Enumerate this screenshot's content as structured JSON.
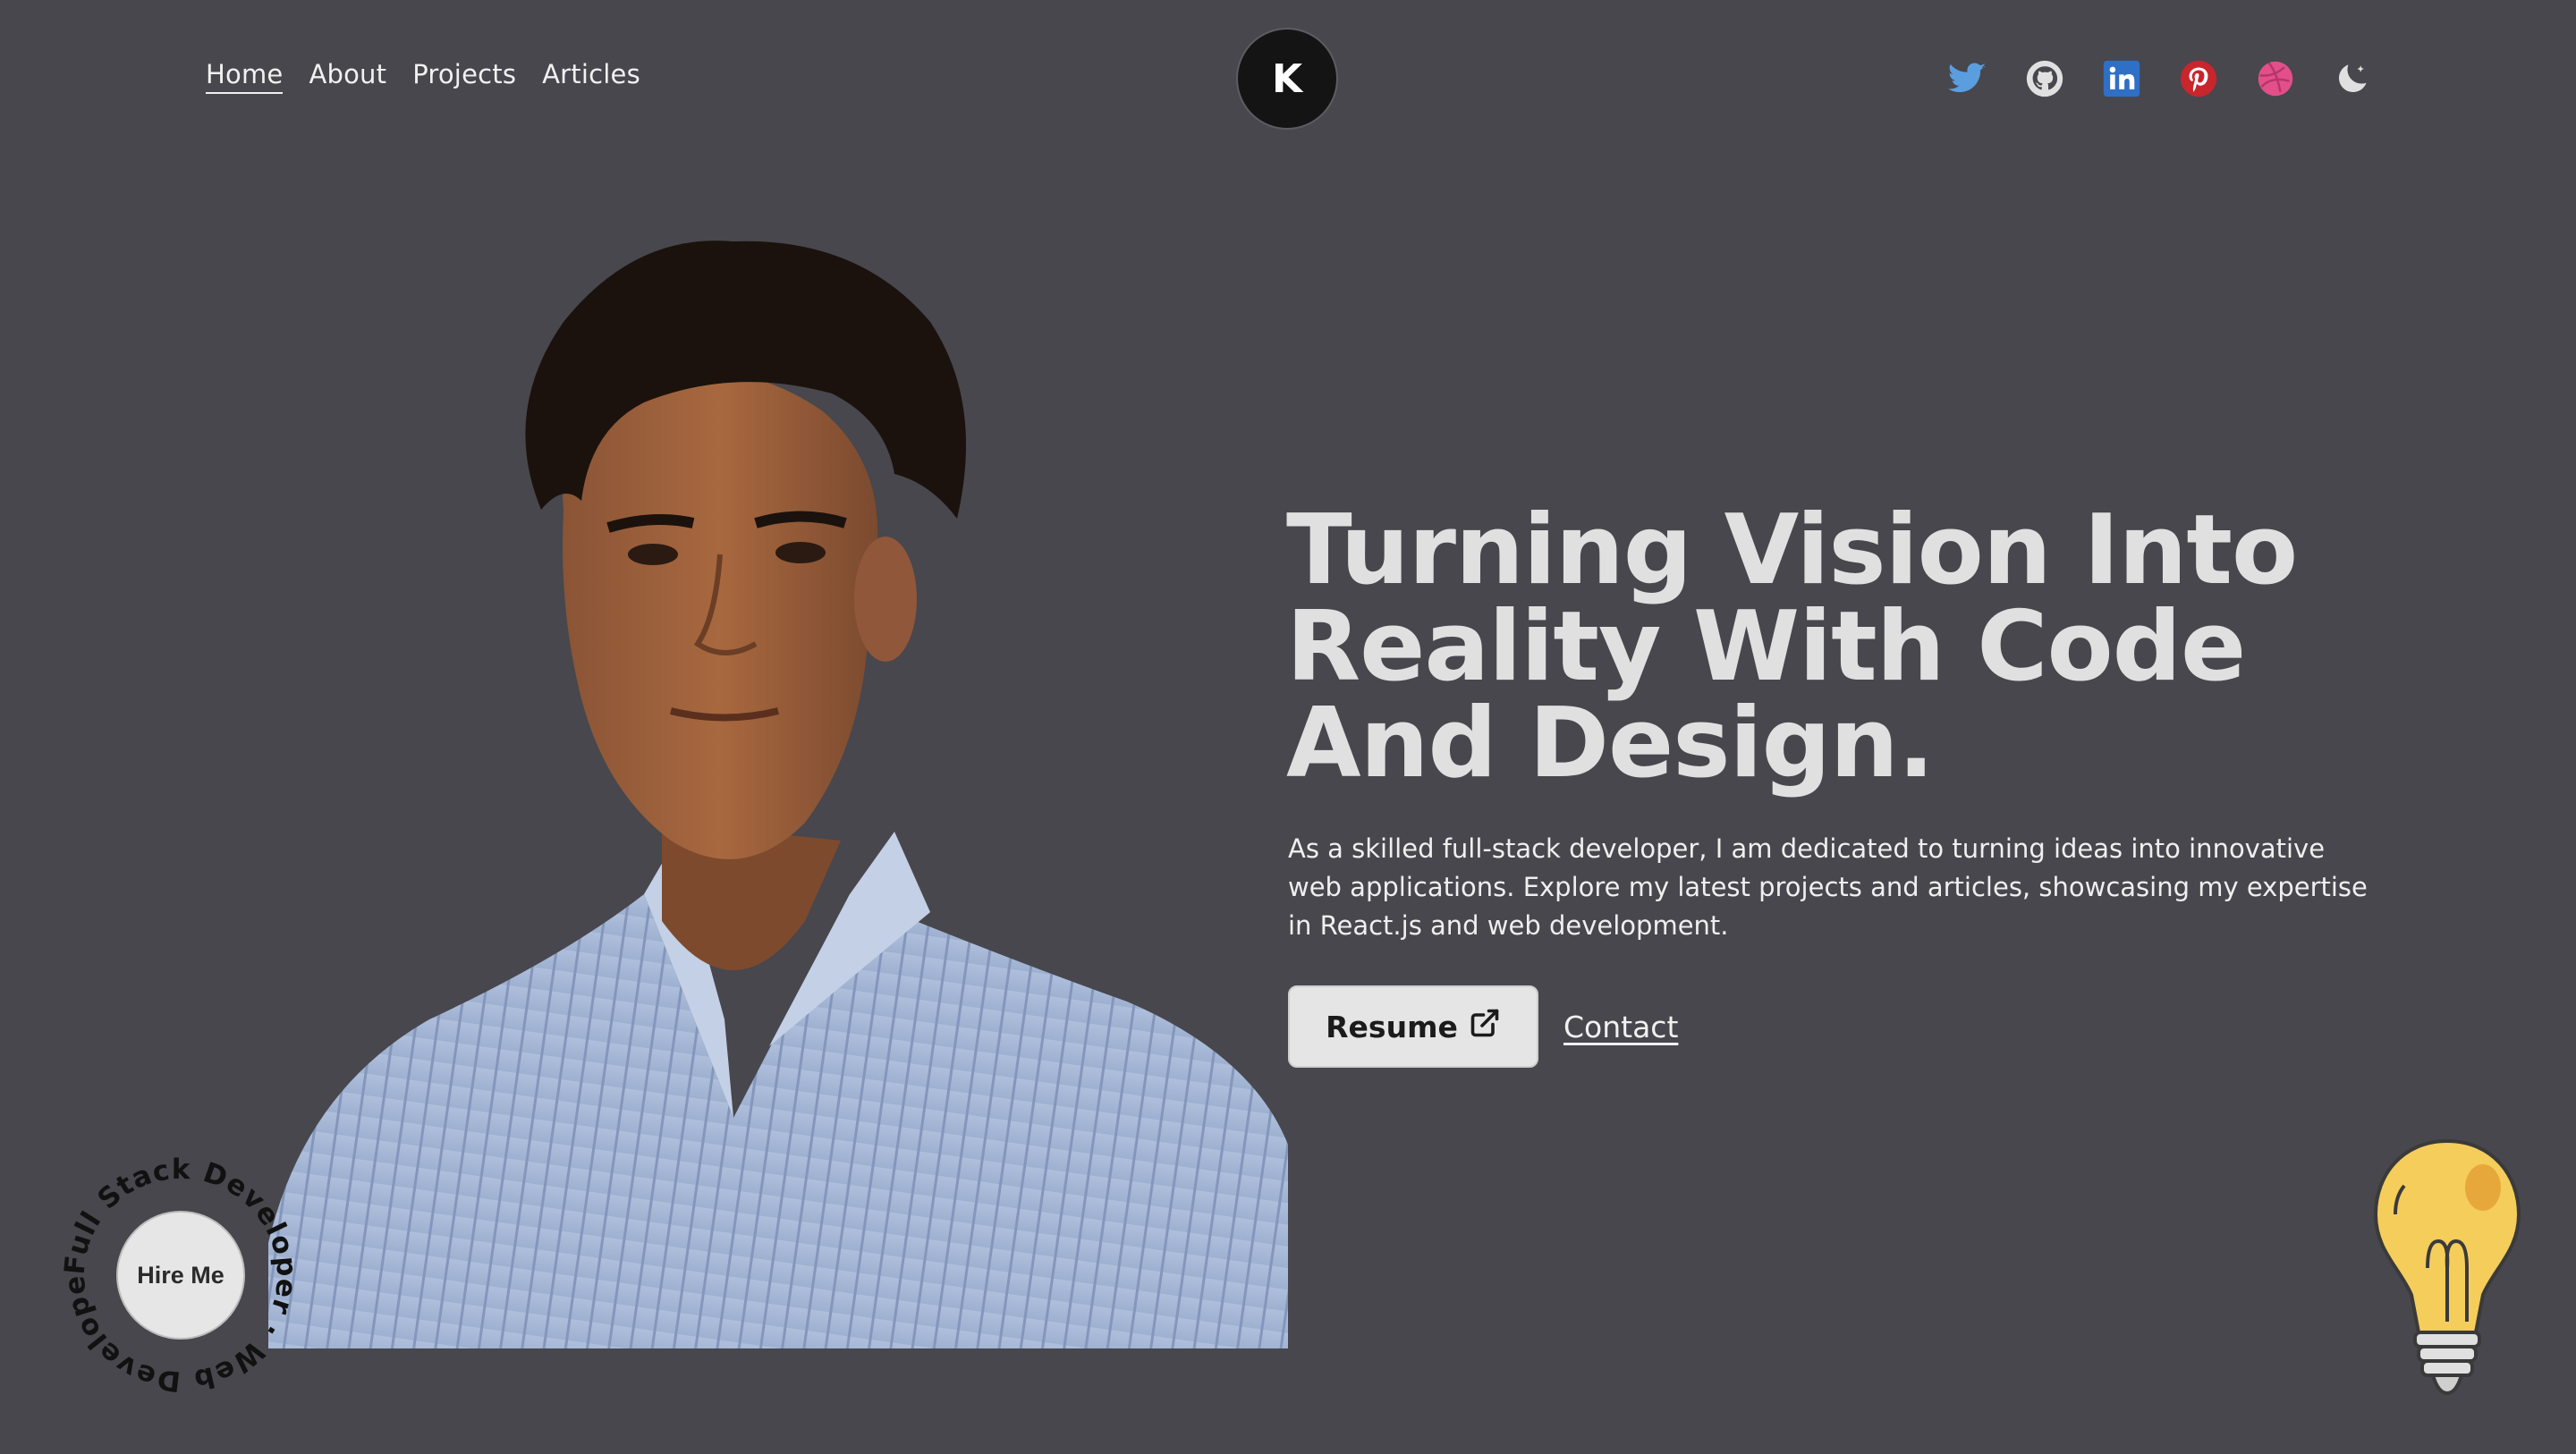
{
  "nav": {
    "links": [
      {
        "label": "Home",
        "active": true
      },
      {
        "label": "About"
      },
      {
        "label": "Projects"
      },
      {
        "label": "Articles"
      }
    ],
    "logo_letter": "K"
  },
  "socials": [
    {
      "icon": "twitter-icon",
      "color": "#5b9ee0"
    },
    {
      "icon": "github-icon",
      "color": "#e0e0e0"
    },
    {
      "icon": "linkedin-icon",
      "color": "#2f6fc6"
    },
    {
      "icon": "pinterest-icon",
      "color": "#c9252c"
    },
    {
      "icon": "dribbble-icon",
      "color": "#e24f89"
    },
    {
      "icon": "moon-icon",
      "color": "#e0e0e0"
    }
  ],
  "hero": {
    "title_lines": [
      "Turning Vision Into",
      "Reality With Code",
      "And Design."
    ],
    "description": "As a skilled full-stack developer, I am dedicated to turning ideas into innovative web applications. Explore my latest projects and articles, showcasing my expertise in React.js and web development.",
    "resume_label": "Resume",
    "contact_label": "Contact"
  },
  "hire": {
    "button_label": "Hire Me",
    "ring_text": "Full Stack Developer · Web Developer ·"
  },
  "colors": {
    "background": "#47474d",
    "title": "#e0e0e0",
    "button_bg": "#e5e5e5"
  }
}
